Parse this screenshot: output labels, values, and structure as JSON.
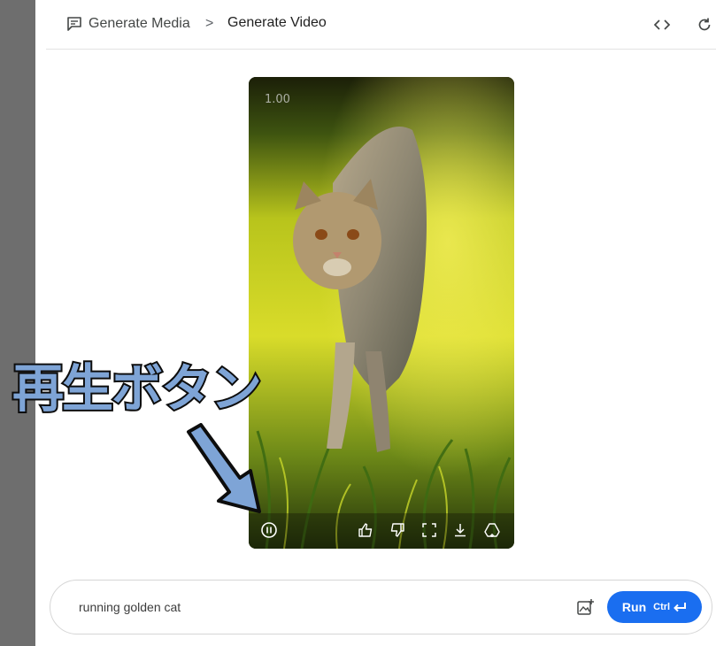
{
  "breadcrumb": {
    "parent_label": "Generate Media",
    "current_label": "Generate Video",
    "separator": ">"
  },
  "header_icons": [
    "code-icon",
    "refresh-icon"
  ],
  "video": {
    "speed_label": "1.00",
    "state": "playing",
    "controls": [
      "pause-icon",
      "thumbs-up-icon",
      "thumbs-down-icon",
      "fullscreen-icon",
      "download-icon",
      "drive-save-icon"
    ]
  },
  "annotation": {
    "label": "再生ボタン",
    "fill_color": "#7ea4d6",
    "stroke_color": "#0d0d0d"
  },
  "prompt": {
    "value": "running golden cat",
    "run_label": "Run",
    "shortcut_label": "Ctrl"
  },
  "colors": {
    "accent": "#1a6ef0",
    "left_strip": "#6e6e6e"
  }
}
